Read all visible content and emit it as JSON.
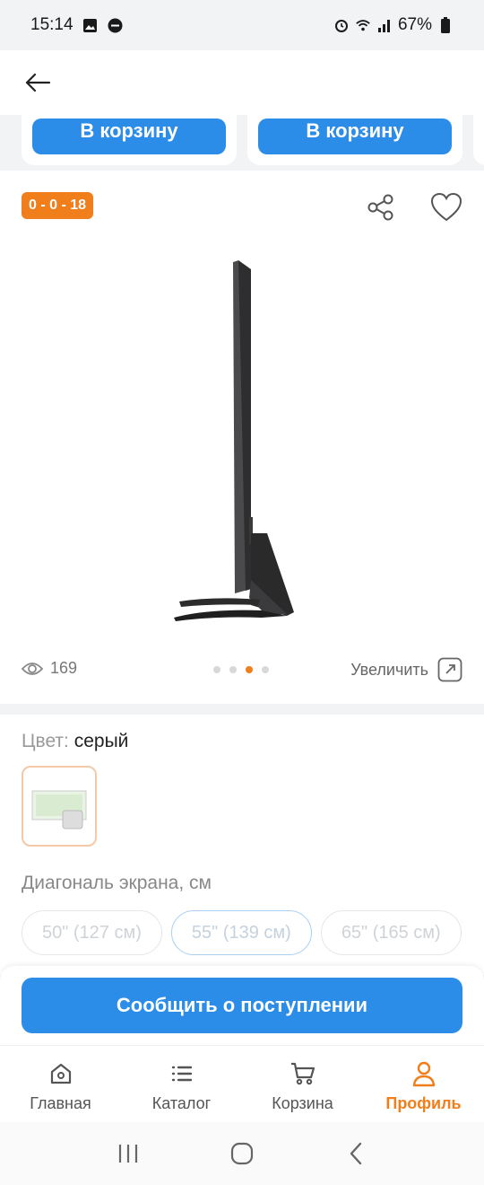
{
  "status_bar": {
    "time": "15:14",
    "battery": "67%"
  },
  "top_cards": [
    {
      "button_label": "В корзину"
    },
    {
      "button_label": "В корзину"
    }
  ],
  "product": {
    "badge": "0 - 0 - 18",
    "views": "169",
    "zoom_label": "Увеличить",
    "carousel": {
      "count": 4,
      "active_index": 2
    }
  },
  "options": {
    "color_label": "Цвет:",
    "color_value": "серый",
    "diagonal_title": "Диагональ экрана, см",
    "diagonal_options": [
      "50\" (127 см)",
      "55\" (139 см)",
      "65\" (165 см)"
    ],
    "diagonal_selected_index": 1
  },
  "notify_button": "Сообщить о поступлении",
  "tabs": [
    {
      "label": "Главная",
      "icon": "home-icon"
    },
    {
      "label": "Каталог",
      "icon": "list-icon"
    },
    {
      "label": "Корзина",
      "icon": "cart-icon"
    },
    {
      "label": "Профиль",
      "icon": "profile-icon",
      "active": true
    }
  ],
  "colors": {
    "accent_blue": "#2b8de8",
    "accent_orange": "#f07e1b"
  }
}
